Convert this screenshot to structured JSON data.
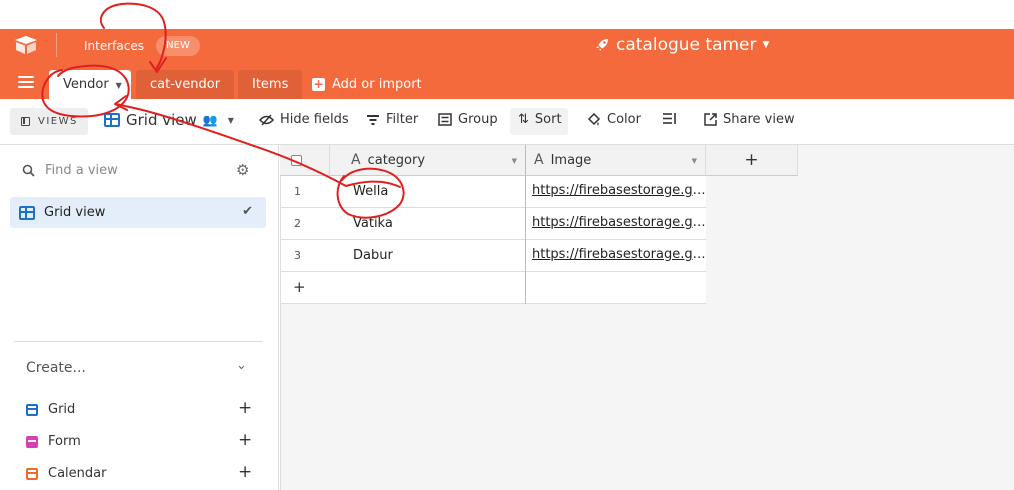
{
  "app": {
    "interfaces_label": "Interfaces",
    "new_badge": "NEW",
    "base_title": "catalogue tamer"
  },
  "tabs": [
    {
      "label": "Vendor"
    },
    {
      "label": "cat-vendor"
    },
    {
      "label": "Items"
    }
  ],
  "add_import_label": "Add or import",
  "toolbar": {
    "views_label": "VIEWS",
    "view_name": "Grid view",
    "hide_fields": "Hide fields",
    "filter": "Filter",
    "group": "Group",
    "sort": "Sort",
    "color": "Color",
    "share_view": "Share view"
  },
  "sidebar": {
    "search_placeholder": "Find a view",
    "views": [
      {
        "label": "Grid view"
      }
    ],
    "create_label": "Create...",
    "create_items": [
      {
        "label": "Grid"
      },
      {
        "label": "Form"
      },
      {
        "label": "Calendar"
      }
    ]
  },
  "grid": {
    "columns": [
      {
        "label": "category"
      },
      {
        "label": "Image"
      }
    ],
    "add_column": "+",
    "rows": [
      {
        "num": "1",
        "category": "Wella",
        "image": "https://firebasestorage.googleapis.com"
      },
      {
        "num": "2",
        "category": "Vatika",
        "image": "https://firebasestorage.googleapis.com"
      },
      {
        "num": "3",
        "category": "Dabur",
        "image": "https://firebasestorage.googleapis.com"
      }
    ],
    "add_row": "+"
  },
  "colors": {
    "accent": "#f46a3c",
    "annotation": "#e02020",
    "selected_view_bg": "#e4eefa"
  }
}
